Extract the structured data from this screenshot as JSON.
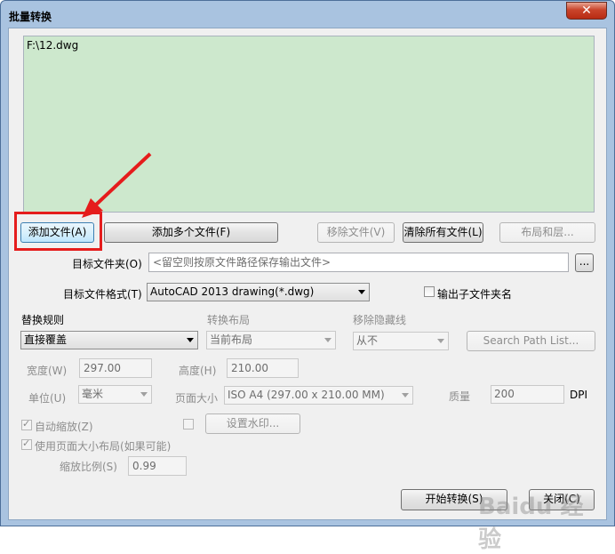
{
  "window": {
    "title": "批量转换",
    "close_glyph": "✕"
  },
  "files": [
    "F:\\12.dwg"
  ],
  "buttons": {
    "add_file": "添加文件(A)",
    "add_multiple": "添加多个文件(F)",
    "remove_file": "移除文件(V)",
    "clear_all": "清除所有文件(L)",
    "layout_layers": "布局和层...",
    "browse": "...",
    "search_path": "Search Path List...",
    "watermark": "设置水印...",
    "start": "开始转换(S)",
    "close": "关闭(C)"
  },
  "target_folder": {
    "label": "目标文件夹(O)",
    "placeholder": "<留空则按原文件路径保存输出文件>"
  },
  "target_format": {
    "label": "目标文件格式(T)",
    "value": "AutoCAD 2013 drawing(*.dwg)"
  },
  "output_subfolder": {
    "label": "输出子文件夹名",
    "checked": false
  },
  "replace_rule": {
    "label": "替换规则",
    "value": "直接覆盖"
  },
  "convert_layout": {
    "label": "转换布局",
    "value": "当前布局"
  },
  "remove_hidden": {
    "label": "移除隐藏线",
    "value": "从不"
  },
  "width": {
    "label": "宽度(W)",
    "value": "297.00"
  },
  "height": {
    "label": "高度(H)",
    "value": "210.00"
  },
  "unit": {
    "label": "单位(U)",
    "value": "毫米"
  },
  "page_size": {
    "label": "页面大小",
    "value": "ISO A4 (297.00 x 210.00 MM)"
  },
  "quality": {
    "label": "质量",
    "value": "200",
    "unit": "DPI"
  },
  "auto_zoom": {
    "label": "自动缩放(Z)",
    "checked": true
  },
  "watermark_enabled": {
    "checked": false
  },
  "use_page_size": {
    "label": "使用页面大小布局(如果可能)",
    "checked": true
  },
  "scale": {
    "label": "缩放比例(S)",
    "value": "0.99"
  },
  "colors": {
    "list_bg": "#cde8cd",
    "highlight": "#e51c1c",
    "arrow": "#e51c1c"
  },
  "brand_watermark": "Baidu 经验"
}
